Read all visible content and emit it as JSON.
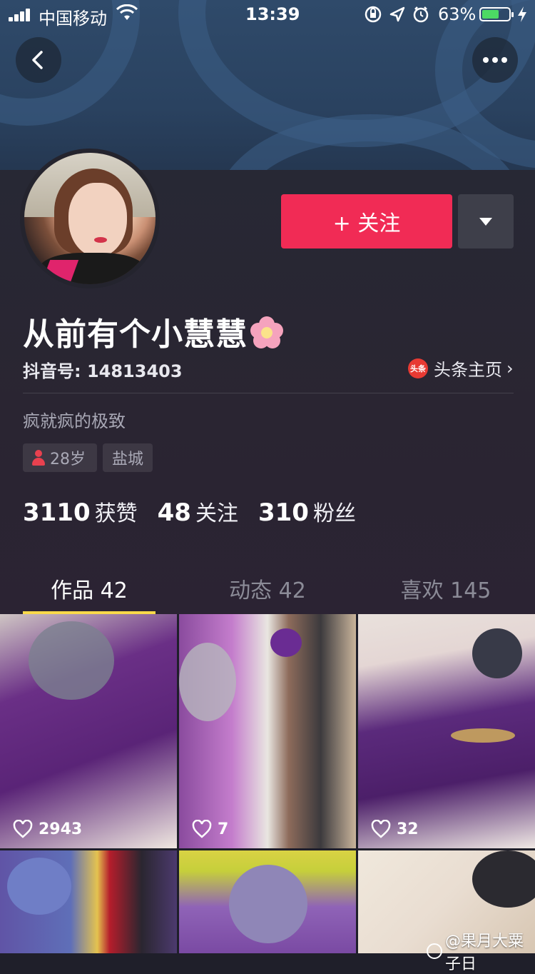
{
  "status_bar": {
    "carrier": "中国移动",
    "time": "13:39",
    "battery_percent": "63%",
    "battery_level": 0.63
  },
  "header": {
    "back_icon": "chevron-left-icon",
    "more_icon": "more-dots-icon"
  },
  "profile": {
    "nickname": "从前有个小慧慧",
    "nickname_emoji": "cherry-blossom-icon",
    "douyin_id": "抖音号: 14813403",
    "toutiao_logo_text": "头条",
    "toutiao_link": "头条主页",
    "bio": "疯就疯的极致",
    "tags": {
      "age": "28岁",
      "city": "盐城"
    },
    "follow_button": "+ 关注",
    "stats": [
      {
        "num": "3110",
        "label": "获赞"
      },
      {
        "num": "48",
        "label": "关注"
      },
      {
        "num": "310",
        "label": "粉丝"
      }
    ]
  },
  "tabs": [
    {
      "label": "作品 42",
      "active": true
    },
    {
      "label": "动态 42",
      "active": false
    },
    {
      "label": "喜欢 145",
      "active": false
    }
  ],
  "videos": [
    {
      "likes": "2943"
    },
    {
      "likes": "7"
    },
    {
      "likes": "32"
    },
    {
      "likes": ""
    },
    {
      "likes": ""
    },
    {
      "likes": ""
    }
  ],
  "watermark": "@果月大粟子日",
  "colors": {
    "follow": "#f12b55",
    "tab_underline": "#f8d94a",
    "background": "#1f1f2a"
  }
}
